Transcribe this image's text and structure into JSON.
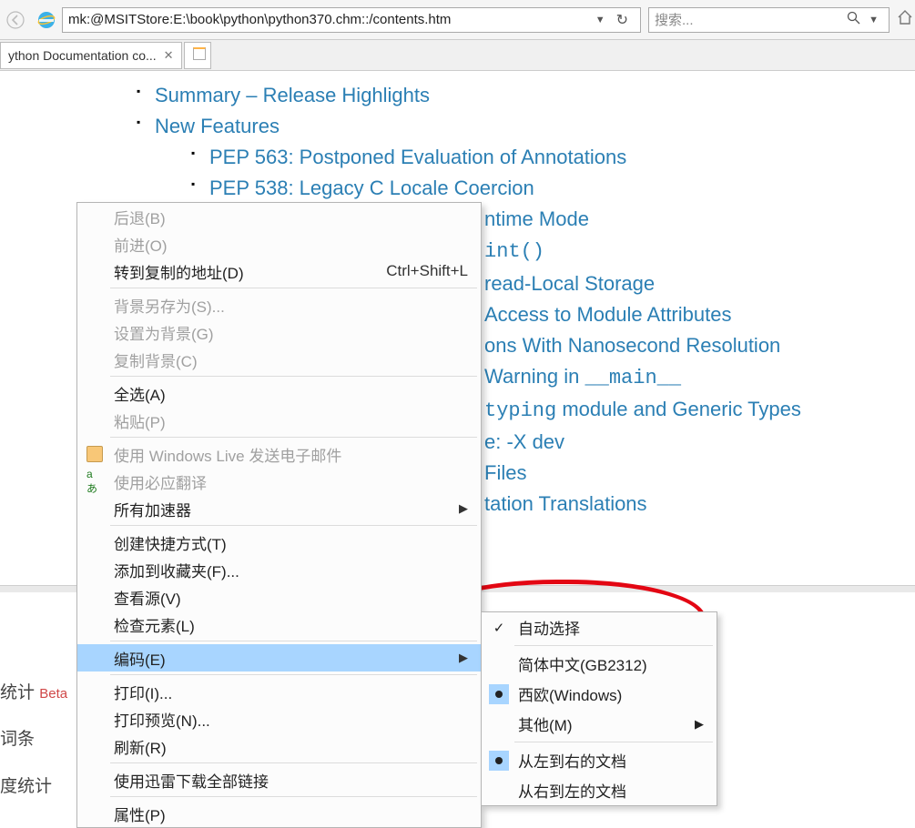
{
  "toolbar": {
    "url": "mk:@MSITStore:E:\\book\\python\\python370.chm::/contents.htm",
    "search_placeholder": "搜索..."
  },
  "tab": {
    "title": "ython Documentation co..."
  },
  "content": {
    "items": [
      "Summary – Release Highlights",
      "New Features"
    ],
    "nested": [
      "PEP 563: Postponed Evaluation of Annotations",
      "PEP 538: Legacy C Locale Coercion"
    ],
    "partial": [
      "ntime Mode",
      "read-Local Storage",
      "Access to Module Attributes",
      "ons With Nanosecond Resolution",
      "e: -X dev",
      "Files",
      "tation Translations"
    ],
    "partial_mono1": "int()",
    "partial_warn_pre": "Warning in ",
    "partial_warn_mono": "__main__",
    "partial_typing_mono": "typing",
    "partial_typing_post": " module and Generic Types"
  },
  "context_menu": [
    {
      "label": "后退(B)",
      "disabled": true
    },
    {
      "label": "前进(O)",
      "disabled": true
    },
    {
      "label": "转到复制的地址(D)",
      "shortcut": "Ctrl+Shift+L"
    },
    {
      "sep": true
    },
    {
      "label": "背景另存为(S)...",
      "disabled": true
    },
    {
      "label": "设置为背景(G)",
      "disabled": true
    },
    {
      "label": "复制背景(C)",
      "disabled": true
    },
    {
      "sep": true
    },
    {
      "label": "全选(A)"
    },
    {
      "label": "粘贴(P)",
      "disabled": true
    },
    {
      "sep": true
    },
    {
      "label": "使用 Windows Live 发送电子邮件",
      "disabled": true,
      "icon": "mail"
    },
    {
      "label": "使用必应翻译",
      "disabled": true,
      "icon": "trans"
    },
    {
      "label": "所有加速器",
      "arrow": true
    },
    {
      "sep": true
    },
    {
      "label": "创建快捷方式(T)"
    },
    {
      "label": "添加到收藏夹(F)..."
    },
    {
      "label": "查看源(V)"
    },
    {
      "label": "检查元素(L)"
    },
    {
      "sep": true
    },
    {
      "label": "编码(E)",
      "arrow": true,
      "highlight": true
    },
    {
      "sep": true
    },
    {
      "label": "打印(I)..."
    },
    {
      "label": "打印预览(N)..."
    },
    {
      "label": "刷新(R)"
    },
    {
      "sep": true
    },
    {
      "label": "使用迅雷下载全部链接"
    },
    {
      "sep": true
    },
    {
      "label": "属性(P)"
    }
  ],
  "sub_menu": [
    {
      "label": "自动选择",
      "check": true
    },
    {
      "sep": true
    },
    {
      "label": "简体中文(GB2312)"
    },
    {
      "label": "西欧(Windows)",
      "radio": true
    },
    {
      "label": "其他(M)",
      "arrow": true
    },
    {
      "sep": true
    },
    {
      "label": "从左到右的文档",
      "radio": true
    },
    {
      "label": "从右到左的文档"
    }
  ],
  "left_fragments": {
    "line1a": "统计 ",
    "line1b": "Beta",
    "line2": "词条",
    "line3": "度统计"
  }
}
